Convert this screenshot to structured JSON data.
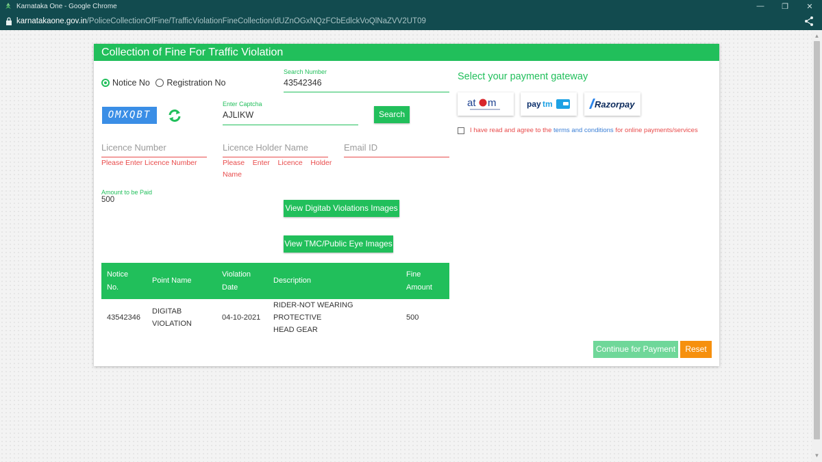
{
  "browser": {
    "window_title": "Karnataka One - Google Chrome",
    "url_host": "karnatakaone.gov.in",
    "url_path": "/PoliceCollectionOfFine/TrafficViolationFineCollection/dUZnOGxNQzFCbEdlckVoQlNaZVV2UT09"
  },
  "card": {
    "title": "Collection of Fine For Traffic Violation"
  },
  "search_type": {
    "options": [
      "Notice No",
      "Registration No"
    ],
    "selected": "Notice No"
  },
  "search_number": {
    "label": "Search Number",
    "value": "43542346"
  },
  "captcha": {
    "code": "OMXQBT",
    "label": "Enter Captcha",
    "value": "AJLIKW",
    "search_button": "Search"
  },
  "licence": {
    "number_placeholder": "Licence Number",
    "number_error": "Please Enter Licence Number",
    "holder_placeholder": "Licence Holder Name",
    "holder_error_line1": "Please    Enter    Licence    Holder",
    "holder_error_line2": "Name",
    "email_placeholder": "Email ID"
  },
  "amount": {
    "label": "Amount to be Paid",
    "value": "500"
  },
  "buttons": {
    "digitab_images": "View Digitab Violations Images",
    "tmc_images": "View TMC/Public Eye Images",
    "continue": "Continue for Payment",
    "reset": "Reset"
  },
  "violations_table": {
    "headers": [
      [
        "Notice",
        "No."
      ],
      [
        "Point Name",
        ""
      ],
      [
        "Violation",
        "Date"
      ],
      [
        "Description",
        ""
      ],
      [
        "Fine",
        "Amount"
      ]
    ],
    "rows": [
      {
        "notice_no": "43542346",
        "point_name_1": "DIGITAB",
        "point_name_2": "VIOLATION",
        "date": "04-10-2021",
        "desc_1": "RIDER-NOT WEARING PROTECTIVE",
        "desc_2": "HEAD GEAR",
        "fine": "500"
      }
    ]
  },
  "gateway": {
    "title": "Select your payment gateway",
    "options": [
      "atom",
      "paytm",
      "Razorpay"
    ],
    "terms_prefix": "I have read and agree to the ",
    "terms_link": "terms and conditions",
    "terms_suffix": " for online payments/services"
  },
  "colors": {
    "brand_green": "#21bf5b",
    "error_red": "#e84a4a",
    "reset_orange": "#f6900e",
    "titlebar": "#124b4f"
  }
}
